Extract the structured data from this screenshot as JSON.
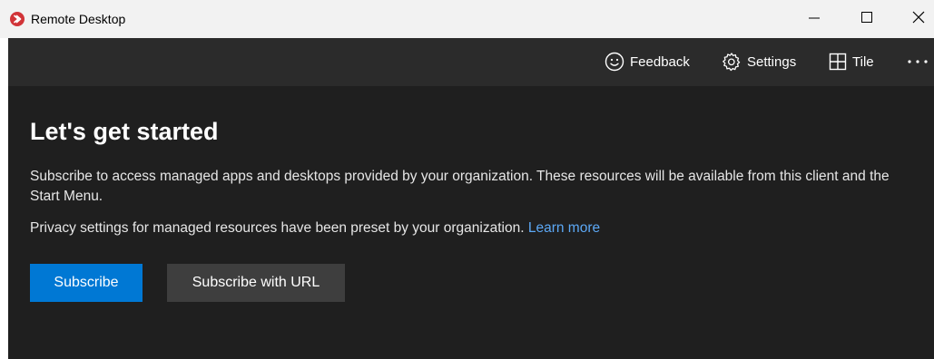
{
  "window": {
    "title": "Remote Desktop",
    "controls": {
      "minimize": "minimize-icon",
      "maximize": "maximize-icon",
      "close": "close-icon"
    }
  },
  "toolbar": {
    "feedback_label": "Feedback",
    "settings_label": "Settings",
    "tile_label": "Tile",
    "more_icon": "more-icon"
  },
  "main": {
    "heading": "Let's get started",
    "paragraph1": "Subscribe to access managed apps and desktops provided by your organization. These resources will be available from this client and the Start Menu.",
    "paragraph2": "Privacy settings for managed resources have been preset by your organization.",
    "learn_more": "Learn more",
    "subscribe_label": "Subscribe",
    "subscribe_url_label": "Subscribe with URL"
  },
  "colors": {
    "accent": "#0078d4",
    "link": "#5ca8f5",
    "app_icon": "#d13438",
    "background": "#1f1f1f",
    "toolbar": "#2b2b2b",
    "secondary_button": "#3e3e3e"
  }
}
